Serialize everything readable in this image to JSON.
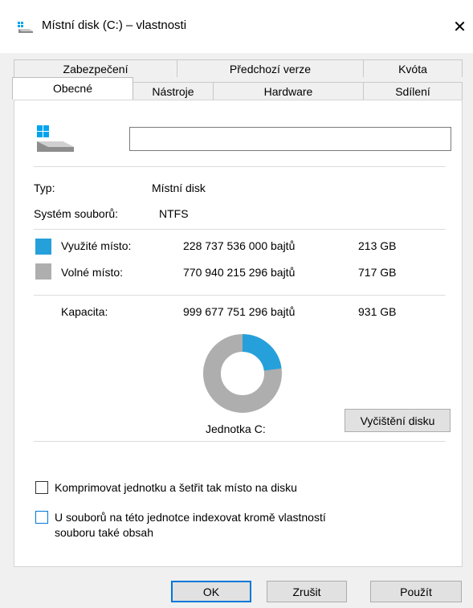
{
  "window": {
    "title": "Místní disk (C:) – vlastnosti",
    "close_glyph": "✕"
  },
  "tabs": {
    "row1": [
      "Zabezpečení",
      "Předchozí verze",
      "Kvóta"
    ],
    "row2": [
      "Obecné",
      "Nástroje",
      "Hardware",
      "Sdílení"
    ],
    "active": "Obecné"
  },
  "general": {
    "drive_name_value": "",
    "type_label": "Typ:",
    "type_value": "Místní disk",
    "fs_label": "Systém souborů:",
    "fs_value": "NTFS",
    "used_label": "Využité místo:",
    "used_bytes": "228 737 536 000 bajtů",
    "used_gb": "213 GB",
    "free_label": "Volné místo:",
    "free_bytes": "770 940 215 296 bajtů",
    "free_gb": "717 GB",
    "capacity_label": "Kapacita:",
    "capacity_bytes": "999 677 751 296 bajtů",
    "capacity_gb": "931 GB",
    "drive_label": "Jednotka C:",
    "cleanup_button": "Vyčištění disku",
    "used_fraction": 0.2288,
    "used_color": "#26a0da",
    "free_color": "#aeaeae"
  },
  "options": {
    "compress_label": "Komprimovat jednotku a šetřit tak místo na disku",
    "compress_checked": false,
    "index_label_line1": "U souborů na této jednotce indexovat kromě vlastností",
    "index_label_line2": "souboru také obsah",
    "index_checked": false
  },
  "buttons": {
    "ok": "OK",
    "cancel": "Zrušit",
    "apply": "Použít"
  }
}
